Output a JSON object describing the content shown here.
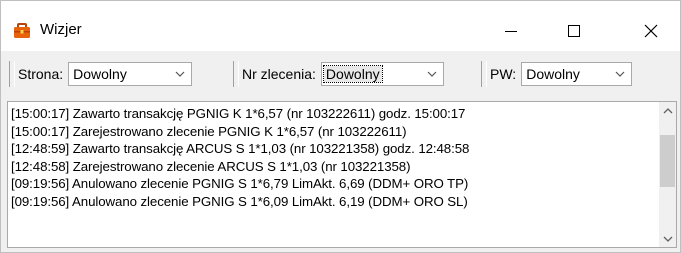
{
  "window": {
    "title": "Wizjer",
    "icon": "briefcase-icon",
    "controls": {
      "minimize": "minimize-icon",
      "maximize": "maximize-icon",
      "close": "close-icon"
    }
  },
  "toolbar": {
    "filters": [
      {
        "label": "Strona:",
        "value": "Dowolny"
      },
      {
        "label": "Nr zlecenia:",
        "value": "Dowolny"
      },
      {
        "label": "PW:",
        "value": "Dowolny"
      }
    ]
  },
  "log": {
    "lines": [
      "[15:00:17] Zawarto transakcję PGNIG K 1*6,57  (nr 103222611) godz. 15:00:17",
      "[15:00:17] Zarejestrowano zlecenie PGNIG K 1*6,57  (nr 103222611)",
      "[12:48:59] Zawarto transakcję ARCUS S 1*1,03  (nr 103221358) godz. 12:48:58",
      "[12:48:58] Zarejestrowano zlecenie ARCUS S 1*1,03  (nr 103221358)",
      "[09:19:56] Anulowano zlecenie PGNIG S 1*6,79  LimAkt. 6,69  (DDM+ ORO TP)",
      "[09:19:56] Anulowano zlecenie PGNIG S 1*6,09  LimAkt. 6,19  (DDM+ ORO SL)"
    ]
  },
  "colors": {
    "icon_accent": "#e8620c",
    "window_bg": "#f0f0f0"
  }
}
